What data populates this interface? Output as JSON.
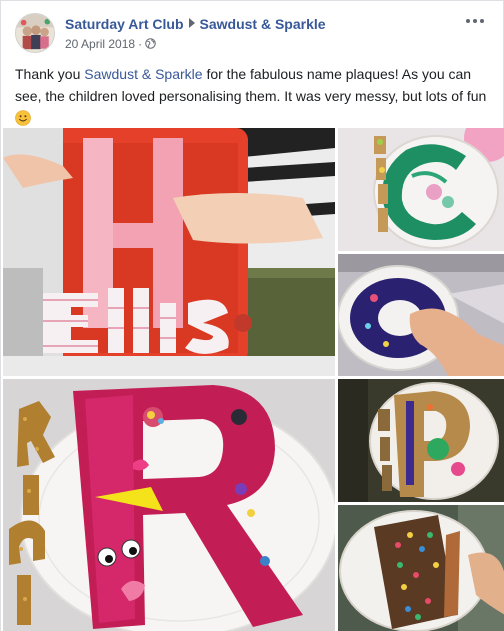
{
  "post": {
    "author": "Saturday Art Club",
    "shared_with": "Sawdust & Sparkle",
    "date": "20 April 2018",
    "privacy_icon": "globe-icon",
    "more_icon": "more-options-icon",
    "caption": {
      "before_mention": "Thank you ",
      "mention": "Sawdust & Sparkle",
      "after_mention": " for the fabulous name plaques! As you can see, the children loved personalising them. It was very messy, but lots of fun",
      "emoji": "slightly-smiling-face"
    }
  },
  "photos": [
    {
      "name": "photo-pink-h-ellis",
      "description": "pink letter H plaque with yarn-wrapped name"
    },
    {
      "name": "photo-green-c-abby",
      "description": "green letter C plaque on paper plate"
    },
    {
      "name": "photo-blue-o-plaque",
      "description": "child painting blue letter O"
    },
    {
      "name": "photo-pink-r-riley",
      "description": "pink letter R plaque with googly eyes"
    },
    {
      "name": "photo-p-plaque-plate",
      "description": "painted letter plaque on paper plate"
    },
    {
      "name": "photo-brown-plaque-plate",
      "description": "brown plaque with sequins on paper plate"
    }
  ],
  "colors": {
    "link": "#385898",
    "text": "#1c1e21",
    "muted": "#606770"
  }
}
